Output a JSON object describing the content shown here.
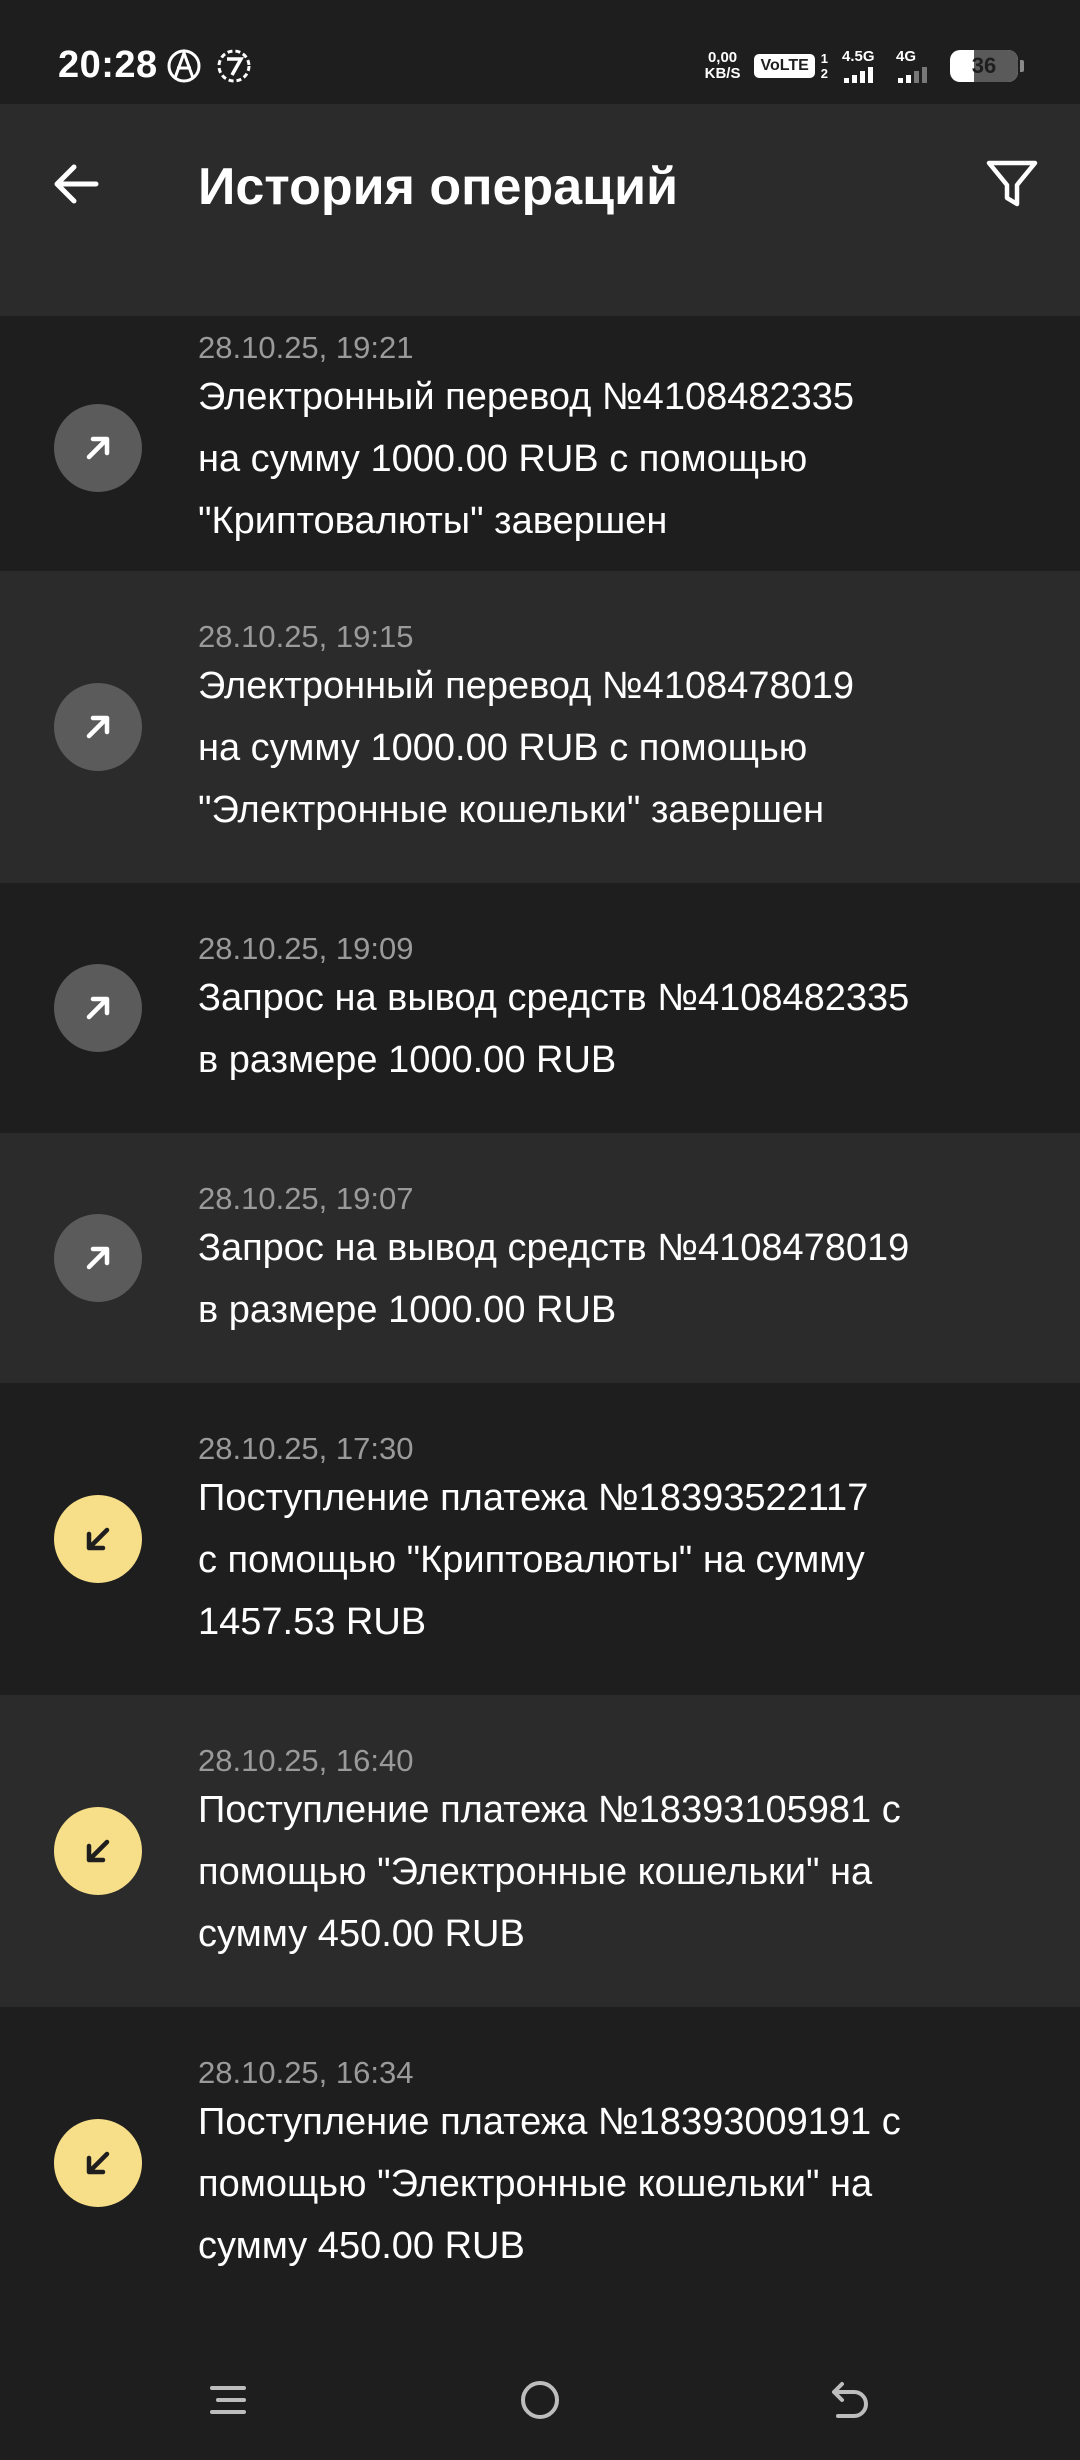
{
  "status_bar": {
    "time": "20:28",
    "net_speed_value": "0,00",
    "net_speed_unit": "KB/S",
    "volte": "VoLTE",
    "sim1": "1",
    "sim2": "2",
    "net1": "4.5G",
    "net2": "4G",
    "battery": "36",
    "battery_level_percent": 36
  },
  "header": {
    "title": "История операций"
  },
  "operations": [
    {
      "direction": "out",
      "datetime": "28.10.25, 19:21",
      "text": "Электронный перевод №4108482335\nна сумму 1000.00 RUB с помощью\n\"Криптовалюты\" завершен"
    },
    {
      "direction": "out",
      "datetime": "28.10.25, 19:15",
      "text": "Электронный перевод №4108478019\nна сумму 1000.00 RUB с помощью\n\"Электронные кошельки\" завершен"
    },
    {
      "direction": "out",
      "datetime": "28.10.25, 19:09",
      "text": "Запрос на вывод средств №4108482335\nв размере 1000.00 RUB"
    },
    {
      "direction": "out",
      "datetime": "28.10.25, 19:07",
      "text": "Запрос на вывод средств №4108478019\nв размере 1000.00 RUB"
    },
    {
      "direction": "in",
      "datetime": "28.10.25, 17:30",
      "text": "Поступление платежа №18393522117\nс помощью \"Криптовалюты\" на сумму\n1457.53 RUB"
    },
    {
      "direction": "in",
      "datetime": "28.10.25, 16:40",
      "text": "Поступление платежа №18393105981 с\nпомощью \"Электронные кошельки\" на\nсумму 450.00 RUB"
    },
    {
      "direction": "in",
      "datetime": "28.10.25, 16:34",
      "text": "Поступление платежа №18393009191 с\nпомощью \"Электронные кошельки\" на\nсумму 450.00 RUB"
    }
  ],
  "colors": {
    "background": "#1e1e1e",
    "header_bg": "#2b2b2b",
    "outgoing_icon_bg": "#5b5b5b",
    "incoming_icon_bg": "#f7de88",
    "date_text": "#9a9a9a"
  },
  "icons": {
    "back": "arrow-left-icon",
    "filter": "filter-icon",
    "outgoing": "arrow-up-right-icon",
    "incoming": "arrow-down-left-icon",
    "nav_menu": "menu-icon",
    "nav_home": "home-circle-icon",
    "nav_back": "back-icon"
  }
}
